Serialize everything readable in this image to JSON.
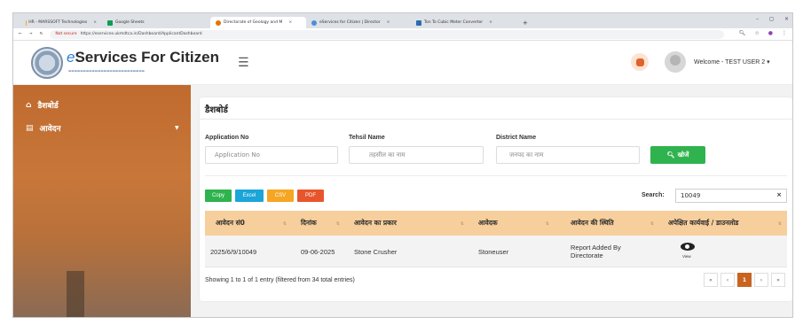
{
  "browser": {
    "tabs": [
      {
        "label": "HR - MARSSOFT Technologies",
        "active": false,
        "color": "#f6a623"
      },
      {
        "label": "Google Sheets",
        "active": false,
        "color": "#0f9d58"
      },
      {
        "label": "Directorate of Geology and M",
        "active": true,
        "color": "#e37400"
      },
      {
        "label": "eServices for Citizen | Director",
        "active": false,
        "color": "#4a90d9"
      },
      {
        "label": "Ton To Cubic Meter Converter",
        "active": false,
        "color": "#2b6cb0"
      }
    ],
    "new_tab": "+",
    "not_secure": "Not secure",
    "url": "https://eservices.ukmdtca.in/Dashboard/ApplicantDashboard"
  },
  "header": {
    "brand_prefix": "e",
    "brand_rest": "Services For Citizen",
    "welcome": "Welcome - TEST USER 2",
    "colors": {
      "accent": "#c8641f",
      "brand_e": "#2f7fd0"
    }
  },
  "sidebar": {
    "items": [
      {
        "label": "डैशबोर्ड",
        "icon": "home-icon"
      },
      {
        "label": "आवेदन",
        "icon": "list-icon",
        "has_submenu": true
      }
    ]
  },
  "main": {
    "title": "डैशबोर्ड",
    "filters": {
      "application_no": {
        "label": "Application No",
        "placeholder": "Application No"
      },
      "tehsil": {
        "label": "Tehsil Name",
        "placeholder": "तहसील का नाम"
      },
      "district": {
        "label": "District Name",
        "placeholder": "जनपद का नाम"
      },
      "search_button": "खोजें"
    },
    "export_buttons": [
      {
        "label": "Copy",
        "color": "#2fb34e"
      },
      {
        "label": "Excel",
        "color": "#1ba5d8"
      },
      {
        "label": "CSV",
        "color": "#f5a623"
      },
      {
        "label": "PDF",
        "color": "#e8552d"
      }
    ],
    "search": {
      "label": "Search:",
      "value": "10049",
      "clear": "×"
    },
    "table": {
      "headers": [
        "आवेदन सं0",
        "दिनांक",
        "आवेदन का प्रकार",
        "आवेदक",
        "आवेदन की स्थिति",
        "अपेक्षित कार्यवाई / डाउनलोड"
      ],
      "rows": [
        {
          "app_no": "2025/6/9/10049",
          "date": "09-06-2025",
          "type": "Stone Crusher",
          "applicant": "Stoneuser",
          "status": "Report Added By Directorate",
          "action": "View"
        }
      ]
    },
    "info": "Showing 1 to 1 of 1 entry (filtered from 34 total entries)",
    "pagination": [
      "«",
      "‹",
      "1",
      "›",
      "»"
    ],
    "current_page": "1"
  }
}
